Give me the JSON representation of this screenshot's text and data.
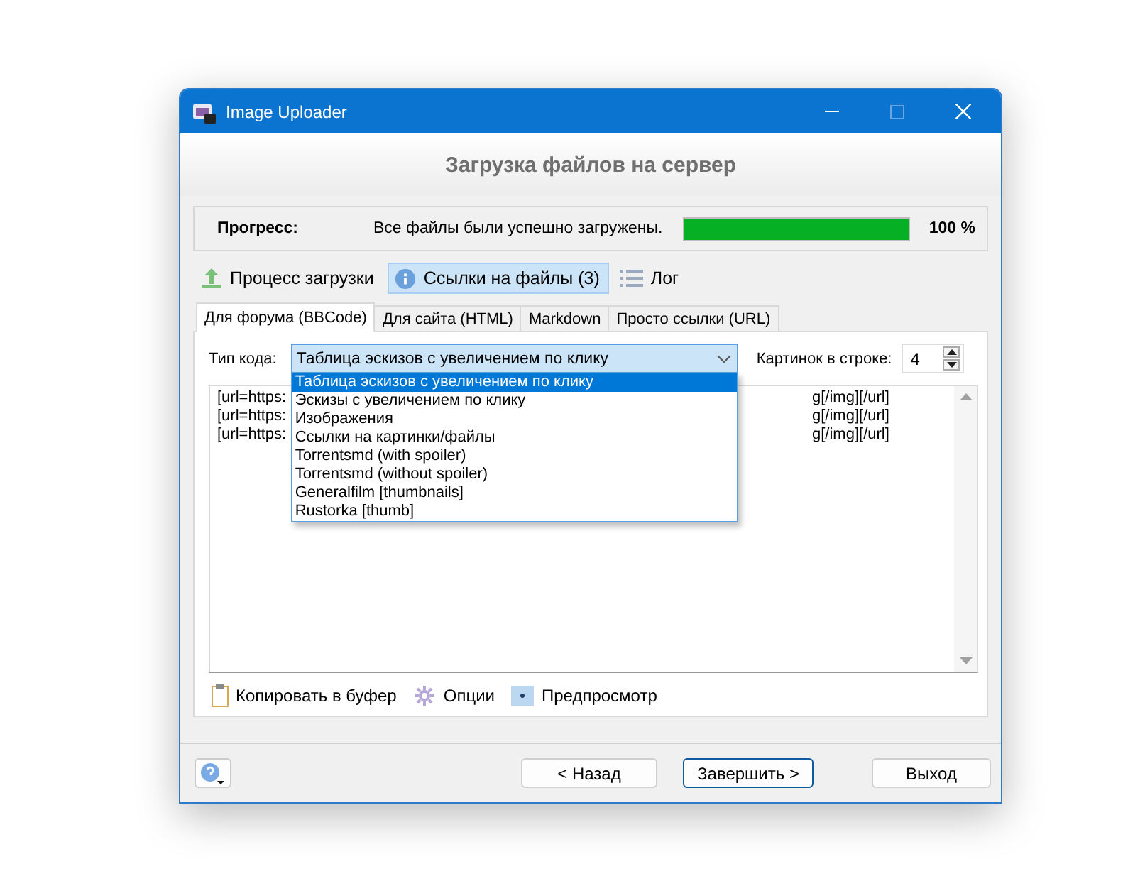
{
  "window": {
    "title": "Image Uploader"
  },
  "header": {
    "title": "Загрузка файлов на сервер"
  },
  "progress": {
    "label": "Прогресс:",
    "status": "Все файлы были успешно загружены.",
    "level": 1,
    "percent": "100 %"
  },
  "nav": [
    {
      "kind": "upload",
      "label": "Процесс загрузки",
      "selected": false
    },
    {
      "kind": "info",
      "label": "Ссылки на файлы (3)",
      "selected": true
    },
    {
      "kind": "log",
      "label": "Лог",
      "selected": false
    }
  ],
  "tabs": [
    {
      "label": "Для форума (BBCode)",
      "selected": true
    },
    {
      "label": "Для сайта (HTML)",
      "selected": false
    },
    {
      "label": "Markdown",
      "selected": false
    },
    {
      "label": "Просто ссылки (URL)",
      "selected": false
    }
  ],
  "code_type": {
    "label": "Тип кода:",
    "value": "Таблица эскизов с увеличением по клику",
    "expanded": true
  },
  "dropdown": [
    {
      "label": "Таблица эскизов с увеличением по клику",
      "selected": true
    },
    {
      "label": "Эскизы с увеличением по клику",
      "selected": false
    },
    {
      "label": "Изображения",
      "selected": false
    },
    {
      "label": "Ссылки на картинки/файлы",
      "selected": false
    },
    {
      "label": "Torrentsmd (with spoiler)",
      "selected": false
    },
    {
      "label": "Torrentsmd (without spoiler)",
      "selected": false
    },
    {
      "label": "Generalfilm [thumbnails]",
      "selected": false
    },
    {
      "label": "Rustorka [thumb]",
      "selected": false
    }
  ],
  "per_row": {
    "label": "Картинок в строке:",
    "value": "4"
  },
  "code_lines": [
    {
      "start": "[url=https:",
      "end": "g[/img][/url]"
    },
    {
      "start": "[url=https:",
      "end": "g[/img][/url]"
    },
    {
      "start": "[url=https:",
      "end": "g[/img][/url]"
    }
  ],
  "actions": [
    {
      "kind": "clipboard",
      "label": "Копировать в буфер"
    },
    {
      "kind": "gear",
      "label": "Опции"
    },
    {
      "kind": "preview",
      "label": "Предпросмотр"
    }
  ],
  "buttons": [
    {
      "label": "< Назад",
      "focused": false
    },
    {
      "label": "Завершить >",
      "focused": true
    },
    {
      "label": "Выход",
      "focused": false
    }
  ]
}
